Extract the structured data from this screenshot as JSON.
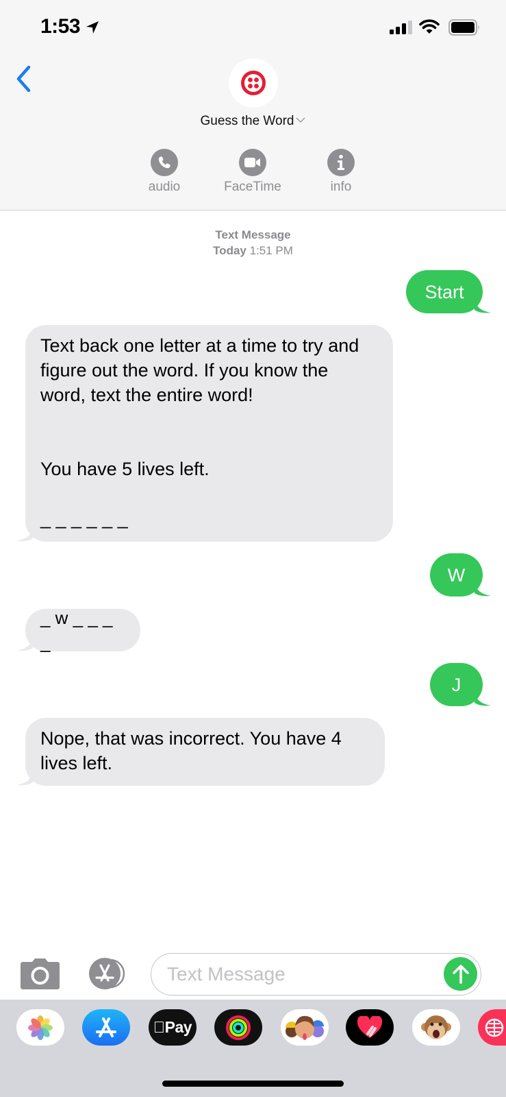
{
  "status_bar": {
    "time": "1:53",
    "icons": [
      "location-arrow-icon",
      "signal-icon",
      "wifi-icon",
      "battery-icon"
    ],
    "signal_bars_active": 3,
    "signal_bars_total": 4
  },
  "header": {
    "back_icon": "chevron-left-icon",
    "contact_name": "Guess the Word",
    "avatar_icon": "twilio-logo-icon",
    "actions": [
      {
        "label": "audio",
        "icon": "phone-icon"
      },
      {
        "label": "FaceTime",
        "icon": "video-camera-icon"
      },
      {
        "label": "info",
        "icon": "info-icon"
      }
    ]
  },
  "conversation": {
    "service": "Text Message",
    "day": "Today",
    "time": "1:51 PM",
    "messages": [
      {
        "direction": "outgoing",
        "text": "Start"
      },
      {
        "direction": "incoming",
        "text": "Text back one letter at a time to try and figure out the word. If you know the word, text the entire word!\n\n\nYou have 5 lives left.\n\n_ _ _ _ _ _"
      },
      {
        "direction": "outgoing",
        "text": "W"
      },
      {
        "direction": "incoming",
        "text": "_ w _ _ _ _"
      },
      {
        "direction": "outgoing",
        "text": "J"
      },
      {
        "direction": "incoming",
        "text": "Nope, that was incorrect. You have 4 lives left."
      }
    ]
  },
  "composer": {
    "camera_icon": "camera-icon",
    "apps_icon": "app-store-icon",
    "placeholder": "Text Message",
    "value": "",
    "send_icon": "arrow-up-icon"
  },
  "app_drawer": {
    "apps": [
      {
        "name": "Photos",
        "icon": "photos-icon"
      },
      {
        "name": "App Store",
        "icon": "app-store-icon"
      },
      {
        "name": "Apple Pay",
        "icon": "apple-pay-icon",
        "label": "Pay"
      },
      {
        "name": "Activity",
        "icon": "activity-rings-icon"
      },
      {
        "name": "Memoji",
        "icon": "memoji-icon"
      },
      {
        "name": "Digital Touch",
        "icon": "digital-touch-heart-icon"
      },
      {
        "name": "Animoji",
        "icon": "monkey-animoji-icon"
      },
      {
        "name": "Web Search",
        "icon": "globe-search-icon"
      }
    ]
  },
  "colors": {
    "outgoing_bubble": "#35c759",
    "incoming_bubble": "#e9e9eb",
    "accent_blue": "#1a7cf0",
    "twilio_red": "#e22035",
    "header_bg": "#f6f6f6",
    "drawer_bg": "#d5d6db"
  }
}
